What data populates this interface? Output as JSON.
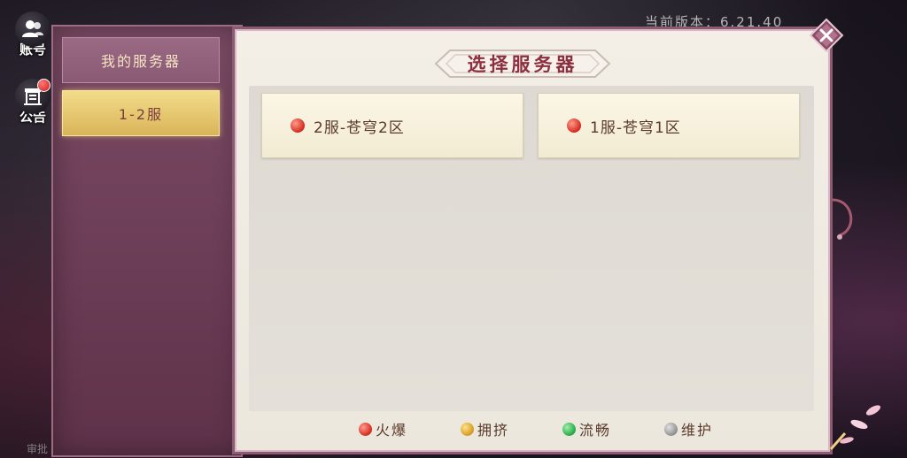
{
  "background": {
    "version_text": "当前版本：6.21.40",
    "bottom_hint": "审批"
  },
  "side_buttons": [
    {
      "label": "账号",
      "icon": "account-icon"
    },
    {
      "label": "公告",
      "icon": "notice-icon",
      "badge": true
    }
  ],
  "left_tabs": [
    {
      "label": "我的服务器",
      "active": false
    },
    {
      "label": "1-2服",
      "active": true
    }
  ],
  "main": {
    "title": "选择服务器",
    "servers": [
      {
        "name": "2服-苍穹2区",
        "status": "火爆",
        "status_color": "#d42a1f"
      },
      {
        "name": "1服-苍穹1区",
        "status": "火爆",
        "status_color": "#d42a1f"
      }
    ],
    "legend": [
      {
        "label": "火爆",
        "color": "#d42a1f"
      },
      {
        "label": "拥挤",
        "color": "#d59b1f"
      },
      {
        "label": "流畅",
        "color": "#23a845"
      },
      {
        "label": "维护",
        "color": "#8f8f8f"
      }
    ]
  },
  "close_icon": "close-icon",
  "colors": {
    "accent": "#8c2f3f",
    "panel_border": "#8c5b72",
    "tab_active": "#d9b45a"
  }
}
